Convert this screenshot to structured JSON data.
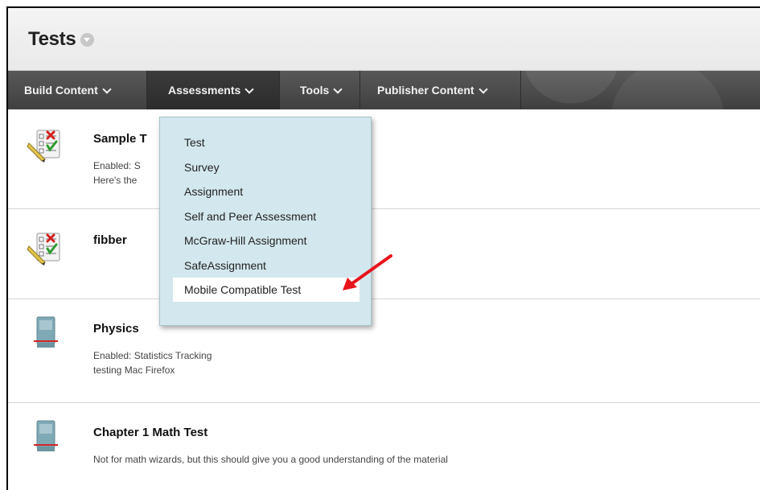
{
  "page": {
    "title": "Tests"
  },
  "action_bar": {
    "items": [
      {
        "label": "Build Content"
      },
      {
        "label": "Assessments"
      },
      {
        "label": "Tools"
      },
      {
        "label": "Publisher Content"
      }
    ]
  },
  "dropdown": {
    "items": [
      {
        "label": "Test"
      },
      {
        "label": "Survey"
      },
      {
        "label": "Assignment"
      },
      {
        "label": "Self and Peer Assessment"
      },
      {
        "label": "McGraw-Hill Assignment"
      },
      {
        "label": "SafeAssignment"
      },
      {
        "label": "Mobile Compatible Test"
      }
    ]
  },
  "content_items": [
    {
      "title": "Sample T",
      "detail_1": "Enabled: S",
      "detail_2": "Here's the"
    },
    {
      "title": "fibber"
    },
    {
      "title": "Physics",
      "detail_1": "Enabled:  Statistics Tracking",
      "detail_2": "testing Mac Firefox"
    },
    {
      "title": "Chapter 1 Math Test",
      "detail_1": "Not for math wizards, but this should give you a good understanding of the material"
    }
  ],
  "colors": {
    "action_bar_bg": "#4a4a4a",
    "dropdown_bg": "#d3e8ee",
    "annotation_arrow": "#e8141b"
  },
  "icons": {
    "test_item": "test-checklist-icon",
    "link_item": "book-link-icon",
    "annotation": "red-arrow-icon"
  }
}
